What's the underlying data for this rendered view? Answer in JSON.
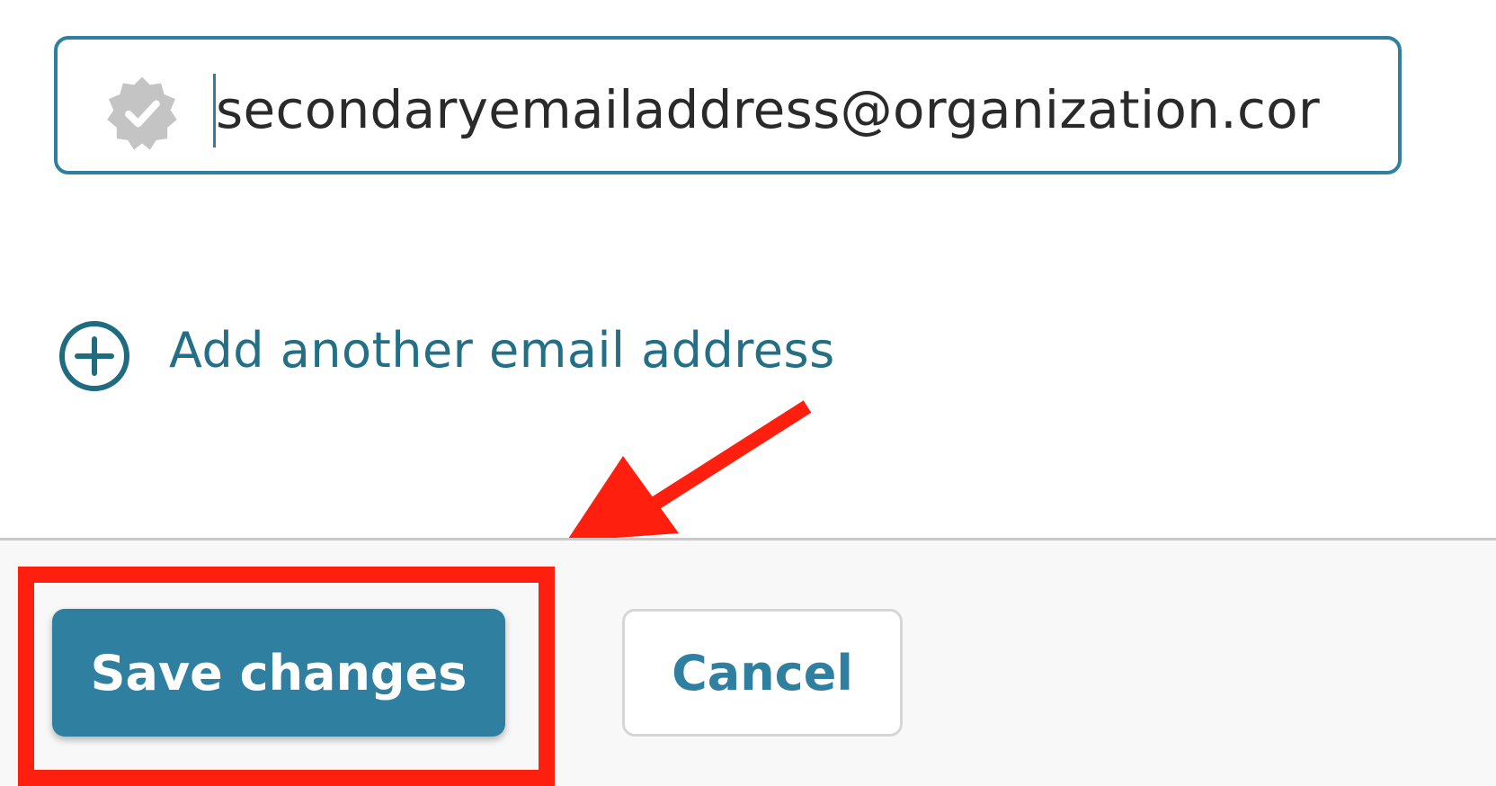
{
  "email_field": {
    "value": "secondaryemailaddress@organization.cor",
    "icon": "verified-badge-icon"
  },
  "add_email": {
    "label": "Add another email address",
    "icon": "plus-circle-icon"
  },
  "footer": {
    "save_label": "Save changes",
    "cancel_label": "Cancel"
  },
  "annotations": {
    "arrow": "red-arrow-icon",
    "highlight": "red-highlight-box"
  },
  "colors": {
    "accent": "#2e7fa0",
    "link": "#226f86",
    "annotation": "#ff1f0f",
    "icon_gray": "#c4c4c4"
  }
}
